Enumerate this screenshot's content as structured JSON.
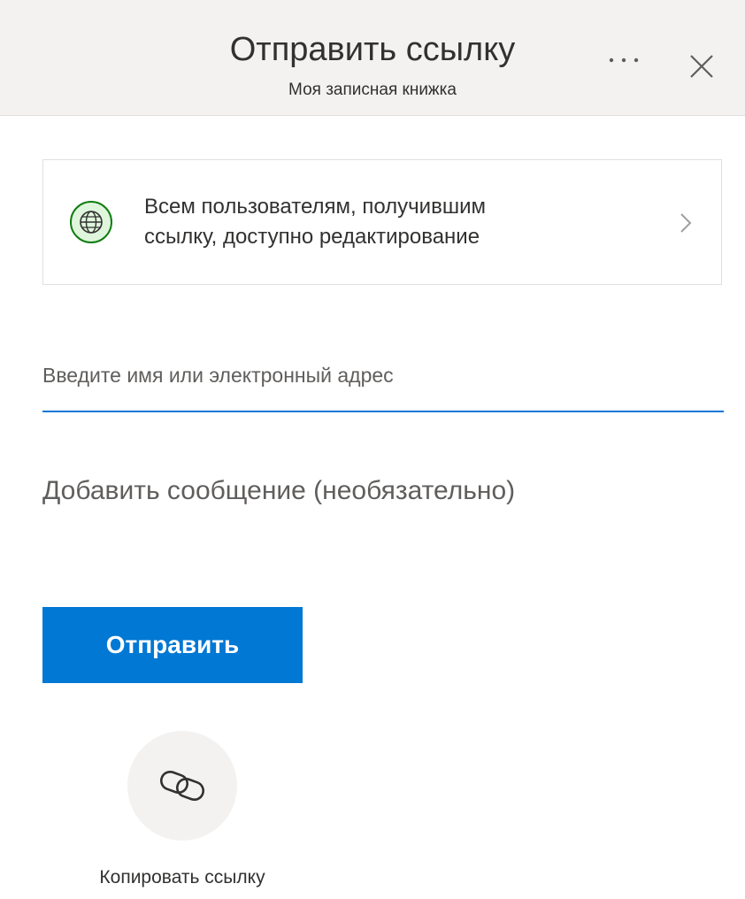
{
  "header": {
    "title": "Отправить ссылку",
    "subtitle": "Моя записная книжка",
    "more_label": "...",
    "more_icon": "more-horizontal-icon",
    "close_icon": "close-icon"
  },
  "permission": {
    "icon": "globe-icon",
    "text_line1": "Всем пользователям, получившим",
    "text_line2": "ссылку, доступно редактирование",
    "chevron_icon": "chevron-right-icon"
  },
  "recipient": {
    "placeholder": "Введите имя или электронный адрес",
    "value": ""
  },
  "message": {
    "placeholder": "Добавить сообщение (необязательно)",
    "value": ""
  },
  "send_button": {
    "label": "Отправить"
  },
  "copy_link": {
    "icon": "link-icon",
    "label": "Копировать ссылку"
  },
  "colors": {
    "accent": "#0078d4",
    "header_bg": "#f4f2f1",
    "globe_green": "#107c10",
    "globe_bg": "#dff6dd"
  }
}
